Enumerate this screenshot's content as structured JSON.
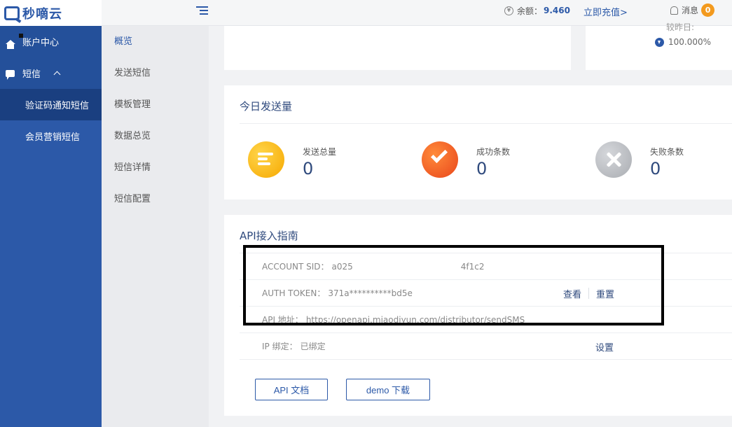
{
  "brand": {
    "name": "秒嘀云"
  },
  "header": {
    "balance_label": "余额：",
    "balance_value": "9.460",
    "recharge_label": "立即充值>",
    "messages_label": "消息",
    "messages_count": "0"
  },
  "sidebar": {
    "items": [
      {
        "label": "账户中心",
        "icon": "home-icon"
      },
      {
        "label": "短信",
        "icon": "chat-icon",
        "expanded": true
      }
    ],
    "sub_items": [
      {
        "label": "验证码通知短信",
        "active": true
      },
      {
        "label": "会员营销短信",
        "active": false
      }
    ]
  },
  "subnav": {
    "items": [
      {
        "label": "概览",
        "active": true
      },
      {
        "label": "发送短信"
      },
      {
        "label": "模板管理"
      },
      {
        "label": "数据总览"
      },
      {
        "label": "短信详情"
      },
      {
        "label": "短信配置"
      }
    ]
  },
  "top_panel": {
    "peek_label": "较昨日:",
    "rate_value": "100.000%"
  },
  "today_send": {
    "title": "今日发送量",
    "stats": [
      {
        "label": "发送总量",
        "value": "0",
        "icon": "list-icon",
        "color": "#f6a800"
      },
      {
        "label": "成功条数",
        "value": "0",
        "icon": "check-icon",
        "color": "#e9461b"
      },
      {
        "label": "失败条数",
        "value": "0",
        "icon": "x-icon",
        "color": "#a9acb1"
      }
    ]
  },
  "api_guide": {
    "title": "API接入指南",
    "account_sid_label": "ACCOUNT SID：",
    "account_sid_prefix": "a025",
    "account_sid_suffix": "4f1c2",
    "auth_token_label": "AUTH TOKEN：",
    "auth_token_value": "371a**********bd5e",
    "view_label": "查看",
    "reset_label": "重置",
    "api_url_label": "API 地址：",
    "api_url_value": "https://openapi.miaodiyun.com/distributor/sendSMS",
    "ip_bind_label": "IP 绑定：",
    "ip_bind_value": "已绑定",
    "settings_label": "设置",
    "doc_button": "API 文档",
    "demo_button": "demo 下载"
  }
}
